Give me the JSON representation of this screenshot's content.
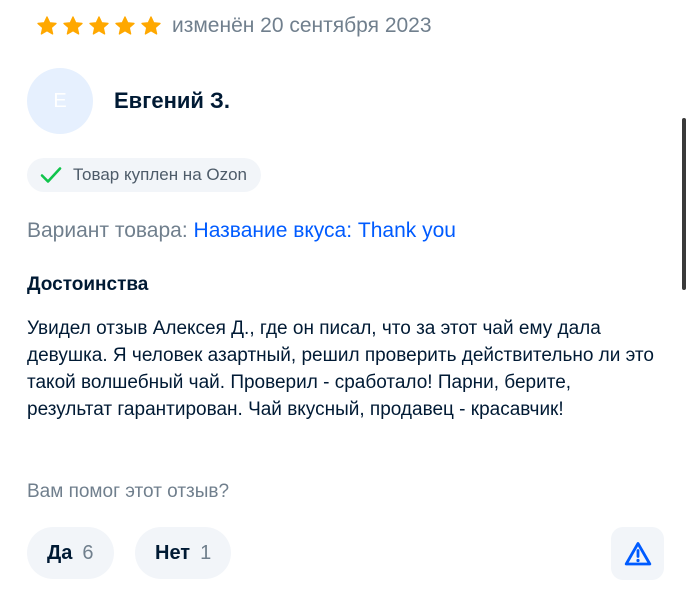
{
  "review": {
    "rating": 5,
    "edited_label": "изменён 20 сентября 2023",
    "author": {
      "initial": "Е",
      "name": "Евгений З."
    },
    "purchase_badge": "Товар куплен на Ozon",
    "variant": {
      "label": "Вариант товара:",
      "value": "Название вкуса: Thank you"
    },
    "section_title": "Достоинства",
    "text": "Увидел отзыв Алексея Д., где он писал, что за этот чай ему дала девушка. Я человек азартный, решил проверить действительно ли это такой волшебный чай. Проверил - сработало! Парни, берите, результат гарантирован. Чай вкусный, продавец - красавчик!"
  },
  "helpful": {
    "question": "Вам помог этот отзыв?",
    "yes_label": "Да",
    "yes_count": "6",
    "no_label": "Нет",
    "no_count": "1",
    "report_icon": "warning-triangle-icon"
  },
  "colors": {
    "star": "#ffa800",
    "accent": "#005bff",
    "check": "#10c44c",
    "muted": "#707f8d"
  }
}
